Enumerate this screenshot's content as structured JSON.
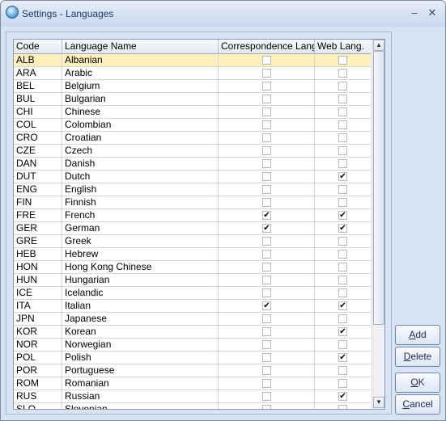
{
  "window": {
    "title": "Settings - Languages"
  },
  "grid": {
    "columns": [
      "Code",
      "Language Name",
      "Correspondence Lang",
      "Web Lang."
    ],
    "rows": [
      {
        "code": "ALB",
        "name": "Albanian",
        "corr": false,
        "web": false
      },
      {
        "code": "ARA",
        "name": "Arabic",
        "corr": false,
        "web": false
      },
      {
        "code": "BEL",
        "name": "Belgium",
        "corr": false,
        "web": false
      },
      {
        "code": "BUL",
        "name": "Bulgarian",
        "corr": false,
        "web": false
      },
      {
        "code": "CHI",
        "name": "Chinese",
        "corr": false,
        "web": false
      },
      {
        "code": "COL",
        "name": "Colombian",
        "corr": false,
        "web": false
      },
      {
        "code": "CRO",
        "name": "Croatian",
        "corr": false,
        "web": false
      },
      {
        "code": "CZE",
        "name": "Czech",
        "corr": false,
        "web": false
      },
      {
        "code": "DAN",
        "name": "Danish",
        "corr": false,
        "web": false
      },
      {
        "code": "DUT",
        "name": "Dutch",
        "corr": false,
        "web": true
      },
      {
        "code": "ENG",
        "name": "English",
        "corr": false,
        "web": false
      },
      {
        "code": "FIN",
        "name": "Finnish",
        "corr": false,
        "web": false
      },
      {
        "code": "FRE",
        "name": "French",
        "corr": true,
        "web": true
      },
      {
        "code": "GER",
        "name": "German",
        "corr": true,
        "web": true
      },
      {
        "code": "GRE",
        "name": "Greek",
        "corr": false,
        "web": false
      },
      {
        "code": "HEB",
        "name": "Hebrew",
        "corr": false,
        "web": false
      },
      {
        "code": "HON",
        "name": "Hong Kong Chinese",
        "corr": false,
        "web": false
      },
      {
        "code": "HUN",
        "name": "Hungarian",
        "corr": false,
        "web": false
      },
      {
        "code": "ICE",
        "name": "Icelandic",
        "corr": false,
        "web": false
      },
      {
        "code": "ITA",
        "name": "Italian",
        "corr": true,
        "web": true
      },
      {
        "code": "JPN",
        "name": "Japanese",
        "corr": false,
        "web": false
      },
      {
        "code": "KOR",
        "name": "Korean",
        "corr": false,
        "web": true
      },
      {
        "code": "NOR",
        "name": "Norwegian",
        "corr": false,
        "web": false
      },
      {
        "code": "POL",
        "name": "Polish",
        "corr": false,
        "web": true
      },
      {
        "code": "POR",
        "name": "Portuguese",
        "corr": false,
        "web": false
      },
      {
        "code": "ROM",
        "name": "Romanian",
        "corr": false,
        "web": false
      },
      {
        "code": "RUS",
        "name": "Russian",
        "corr": false,
        "web": true
      },
      {
        "code": "SLO",
        "name": "Slovenian",
        "corr": false,
        "web": false
      }
    ],
    "selected_index": 0,
    "selected_color": "#ffefbd"
  },
  "buttons": {
    "add": {
      "mnemonic": "A",
      "rest": "dd"
    },
    "delete": {
      "mnemonic": "D",
      "rest": "elete"
    },
    "ok": {
      "mnemonic": "O",
      "rest": "K"
    },
    "cancel": {
      "mnemonic": "C",
      "rest": "ancel"
    }
  },
  "icons": {
    "minimize": "minimize-icon",
    "close": "close-icon",
    "check": "✔"
  }
}
